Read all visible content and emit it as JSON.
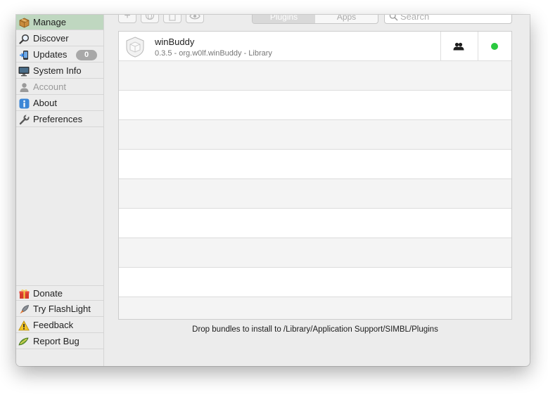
{
  "sidebar": {
    "items": [
      {
        "label": "Manage",
        "icon": "package-icon",
        "active": true
      },
      {
        "label": "Discover",
        "icon": "magnifier-icon"
      },
      {
        "label": "Updates",
        "icon": "updates-icon",
        "badge": "0"
      },
      {
        "label": "System Info",
        "icon": "monitor-icon"
      },
      {
        "label": "Account",
        "icon": "user-icon",
        "disabled": true
      },
      {
        "label": "About",
        "icon": "info-icon"
      },
      {
        "label": "Preferences",
        "icon": "wrench-icon"
      }
    ],
    "bottom_items": [
      {
        "label": "Donate",
        "icon": "gift-icon"
      },
      {
        "label": "Try FlashLight",
        "icon": "rocket-icon"
      },
      {
        "label": "Feedback",
        "icon": "warning-icon"
      },
      {
        "label": "Report Bug",
        "icon": "bug-icon"
      }
    ]
  },
  "toolbar": {
    "segments": {
      "plugins": "Plugins",
      "apps": "Apps"
    },
    "search_placeholder": "Search"
  },
  "plugins": [
    {
      "name": "winBuddy",
      "meta": "0.3.5 - org.w0lf.winBuddy - Library",
      "status": "enabled",
      "status_color": "#2bc93f"
    }
  ],
  "footer_text": "Drop bundles to install to /Library/Application Support/SIMBL/Plugins",
  "colors": {
    "active_nav": "#bfd7c0",
    "status_green": "#2bc93f"
  }
}
